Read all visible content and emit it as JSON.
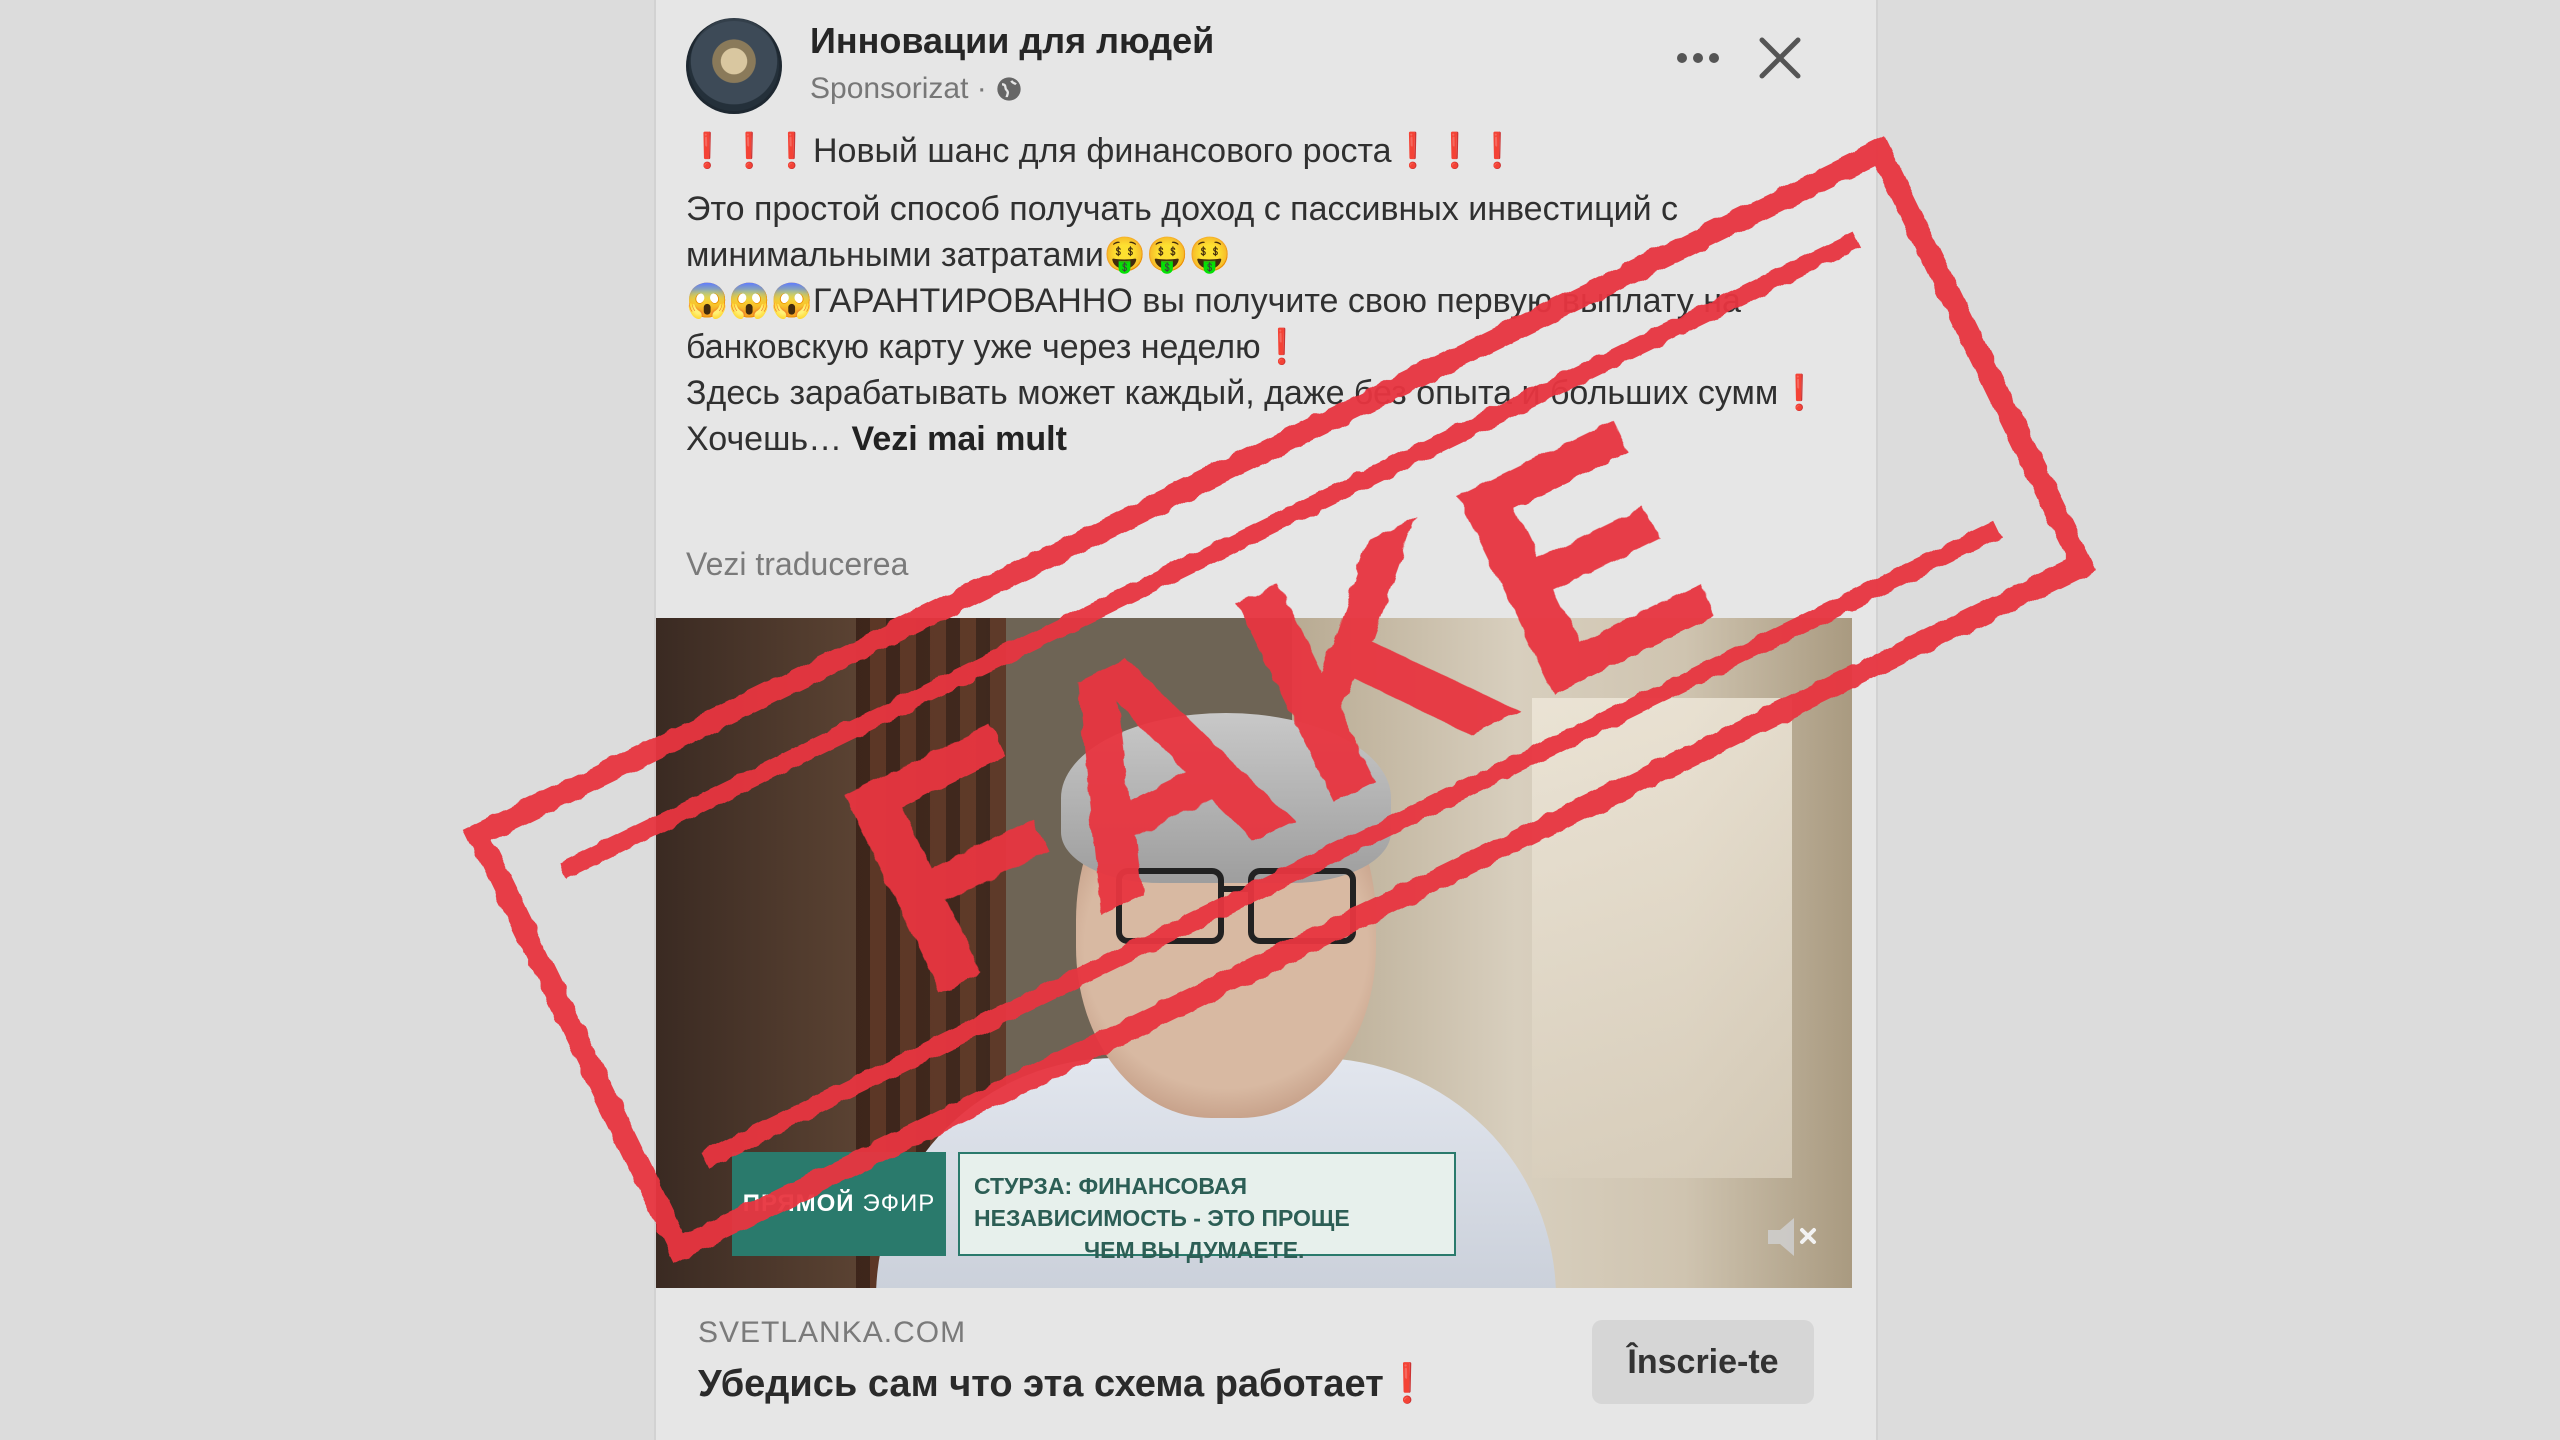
{
  "post": {
    "page_name": "Инновации для людей",
    "sponsored": "Sponsorizat ·",
    "headline": "❗❗❗Новый шанс для финансового роста❗❗❗",
    "body_lines": [
      "Это простой способ получать доход с пассивных инвестиций с минимальными затратами🤑🤑🤑",
      "😱😱😱ГАРАНТИРОВАННО вы получите свою первую выплату на банковскую карту уже через неделю❗",
      "Здесь зарабатывать может каждый, даже без опыта и больших сумм❗",
      "Хочешь"
    ],
    "see_more": "Vezi mai mult",
    "translate": "Vezi traducerea"
  },
  "video": {
    "live_label_bold": "ПРЯМОЙ",
    "live_label": "ЭФИР",
    "caption_line1": "СТУРЗА: ФИНАНСОВАЯ НЕЗАВИСИМОСТЬ - ЭТО ПРОЩЕ",
    "caption_line2": "ЧЕМ ВЫ ДУМАЕТЕ."
  },
  "footer": {
    "domain": "SVETLANKA.COM",
    "title": "Убедись сам что эта схема работает❗",
    "cta": "Înscrie-te"
  },
  "stamp": {
    "text": "FAKE",
    "color": "#e8363f"
  },
  "icons": [
    "globe-icon",
    "more-icon",
    "close-icon",
    "mute-icon"
  ]
}
